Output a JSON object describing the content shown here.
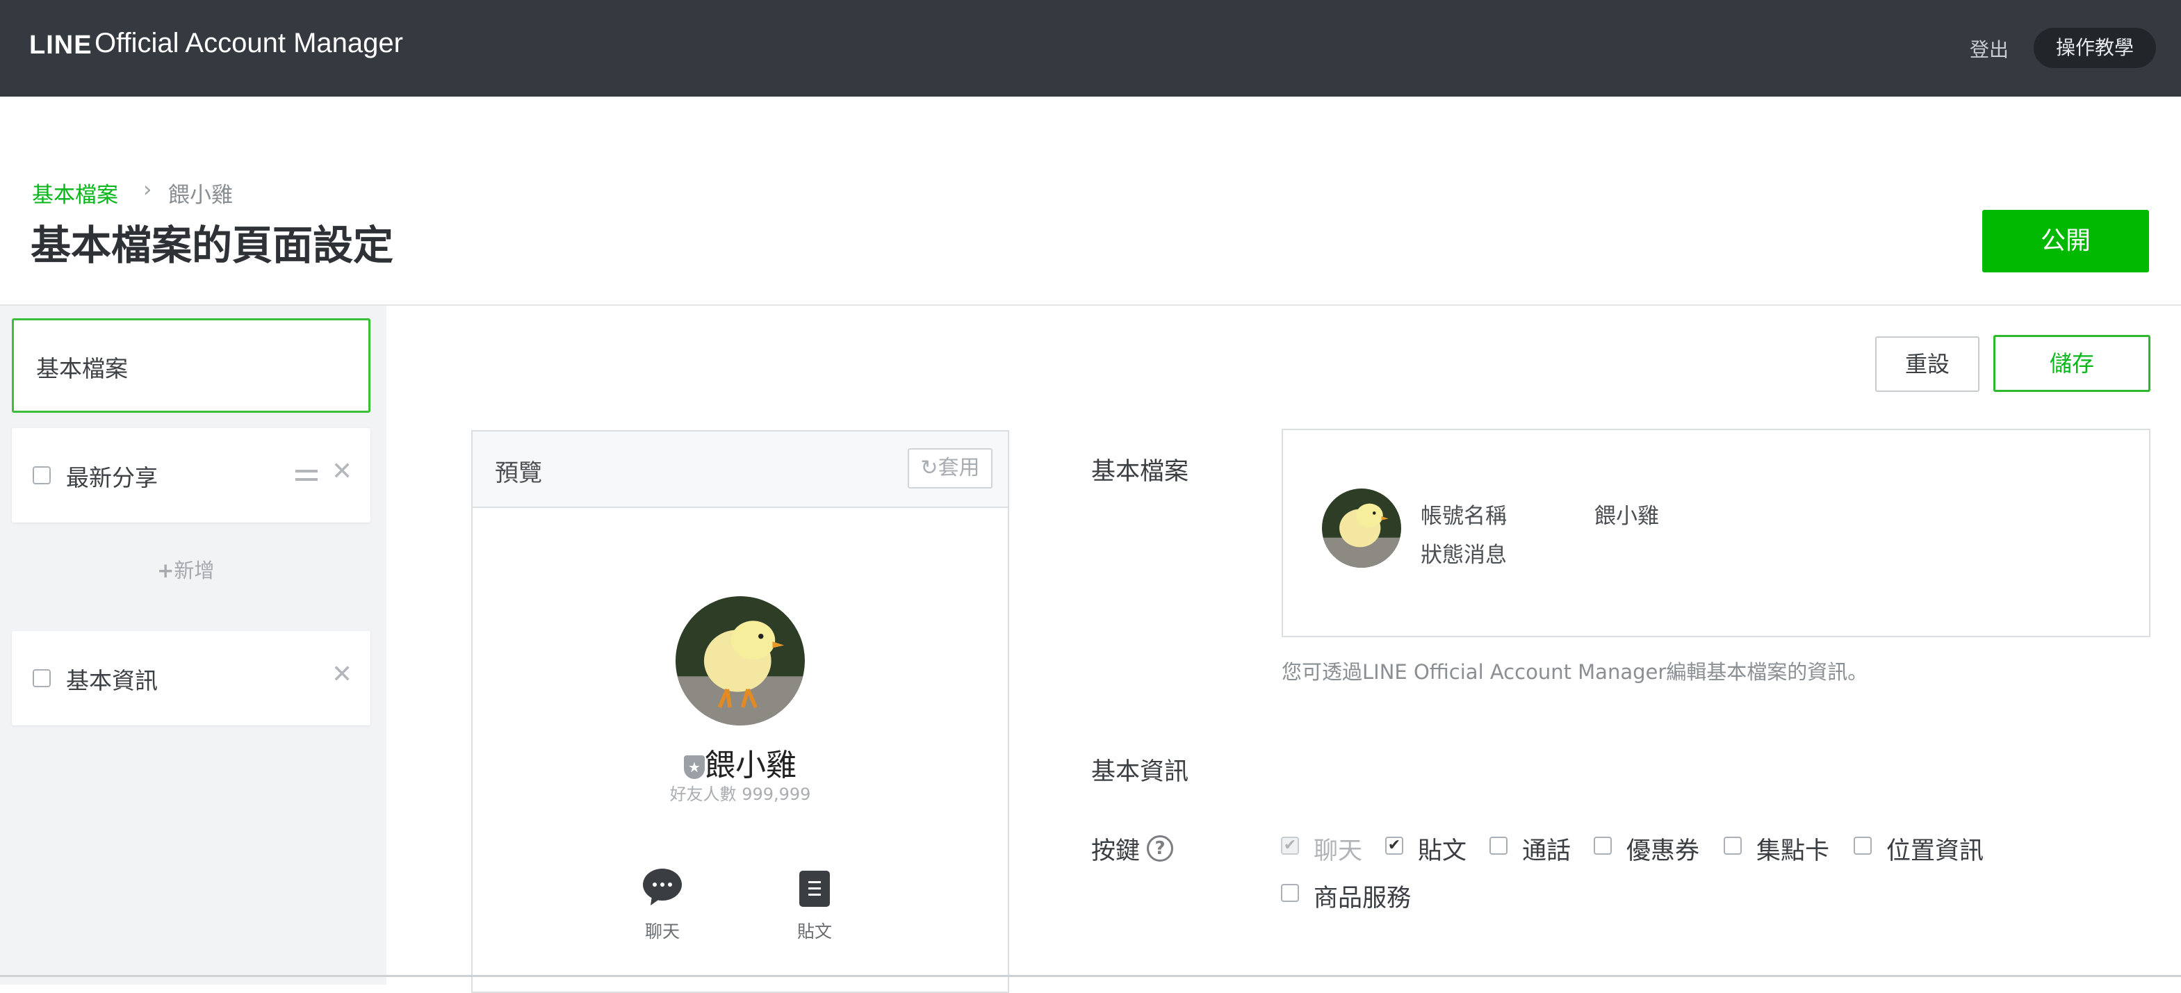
{
  "header": {
    "brand_logo": "LINE",
    "brand_name": "Official Account Manager",
    "logout": "登出",
    "tutorial": "操作教學"
  },
  "breadcrumb": {
    "parent": "基本檔案",
    "separator": "›",
    "current": "餵小雞"
  },
  "page_title": "基本檔案的頁面設定",
  "publish_label": "公開",
  "sidebar": {
    "active_item": "基本檔案",
    "items": [
      {
        "label": "最新分享",
        "checked": false
      },
      {
        "label": "基本資訊",
        "checked": false
      }
    ],
    "add_label": "新增"
  },
  "toolbar": {
    "reset_label": "重設",
    "save_label": "儲存"
  },
  "preview": {
    "title": "預覽",
    "apply_label": "套用",
    "account_name": "餵小雞",
    "friends_count": "好友人數 999,999",
    "tabs": [
      {
        "label": "聊天",
        "icon": "chat-bubble-icon"
      },
      {
        "label": "貼文",
        "icon": "post-icon"
      }
    ]
  },
  "profile_section": {
    "label": "基本檔案",
    "fields": [
      {
        "key": "帳號名稱",
        "value": "餵小雞"
      },
      {
        "key": "狀態消息",
        "value": ""
      }
    ],
    "help": "您可透過LINE Official Account Manager編輯基本檔案的資訊。"
  },
  "basic_info_label": "基本資訊",
  "buttons_section": {
    "label": "按鍵",
    "options": [
      {
        "label": "聊天",
        "checked": true,
        "disabled": true
      },
      {
        "label": "貼文",
        "checked": true,
        "disabled": false
      },
      {
        "label": "通話",
        "checked": false,
        "disabled": false
      },
      {
        "label": "優惠券",
        "checked": false,
        "disabled": false
      },
      {
        "label": "集點卡",
        "checked": false,
        "disabled": false
      },
      {
        "label": "位置資訊",
        "checked": false,
        "disabled": false
      },
      {
        "label": "商品服務",
        "checked": false,
        "disabled": false
      }
    ]
  },
  "colors": {
    "accent": "#06b718",
    "topbar": "#353a40",
    "publish": "#00b900"
  }
}
